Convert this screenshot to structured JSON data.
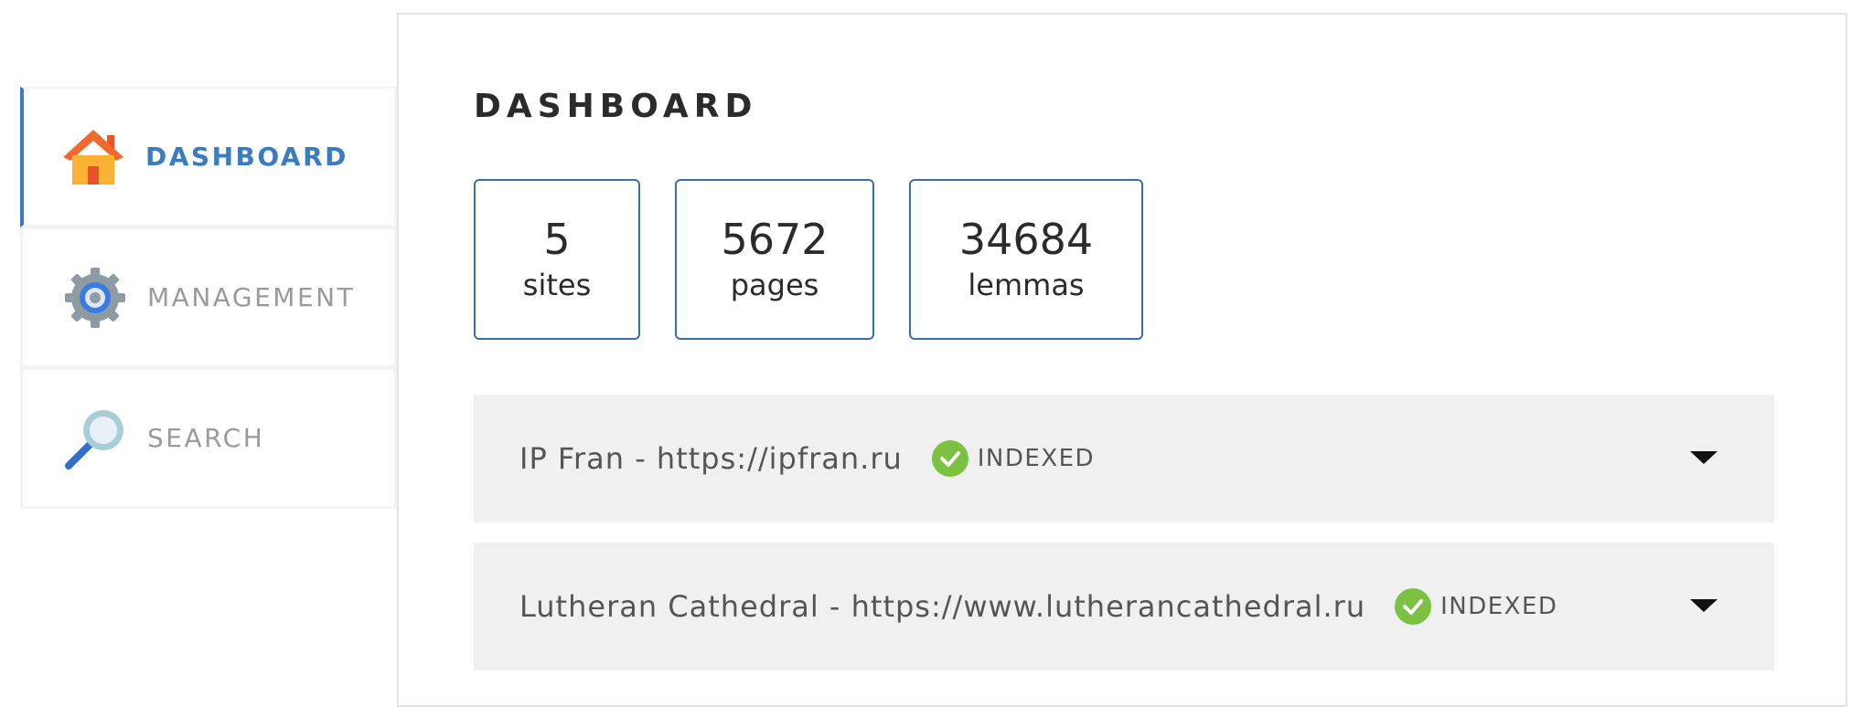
{
  "sidebar": {
    "items": [
      {
        "label": "DASHBOARD",
        "icon": "home-icon",
        "active": true
      },
      {
        "label": "MANAGEMENT",
        "icon": "gear-icon",
        "active": false
      },
      {
        "label": "SEARCH",
        "icon": "magnifier-icon",
        "active": false
      }
    ]
  },
  "main": {
    "title": "DASHBOARD",
    "stats": [
      {
        "value": "5",
        "label": "sites"
      },
      {
        "value": "5672",
        "label": "pages"
      },
      {
        "value": "34684",
        "label": "lemmas"
      }
    ],
    "sites": [
      {
        "name": "IP Fran - https://ipfran.ru",
        "status": "INDEXED"
      },
      {
        "name": "Lutheran Cathedral - https://www.lutherancathedral.ru",
        "status": "INDEXED"
      }
    ]
  },
  "colors": {
    "accent": "#3b7bbf",
    "status_ok": "#7cc242",
    "row_background": "#f0f0f0"
  }
}
